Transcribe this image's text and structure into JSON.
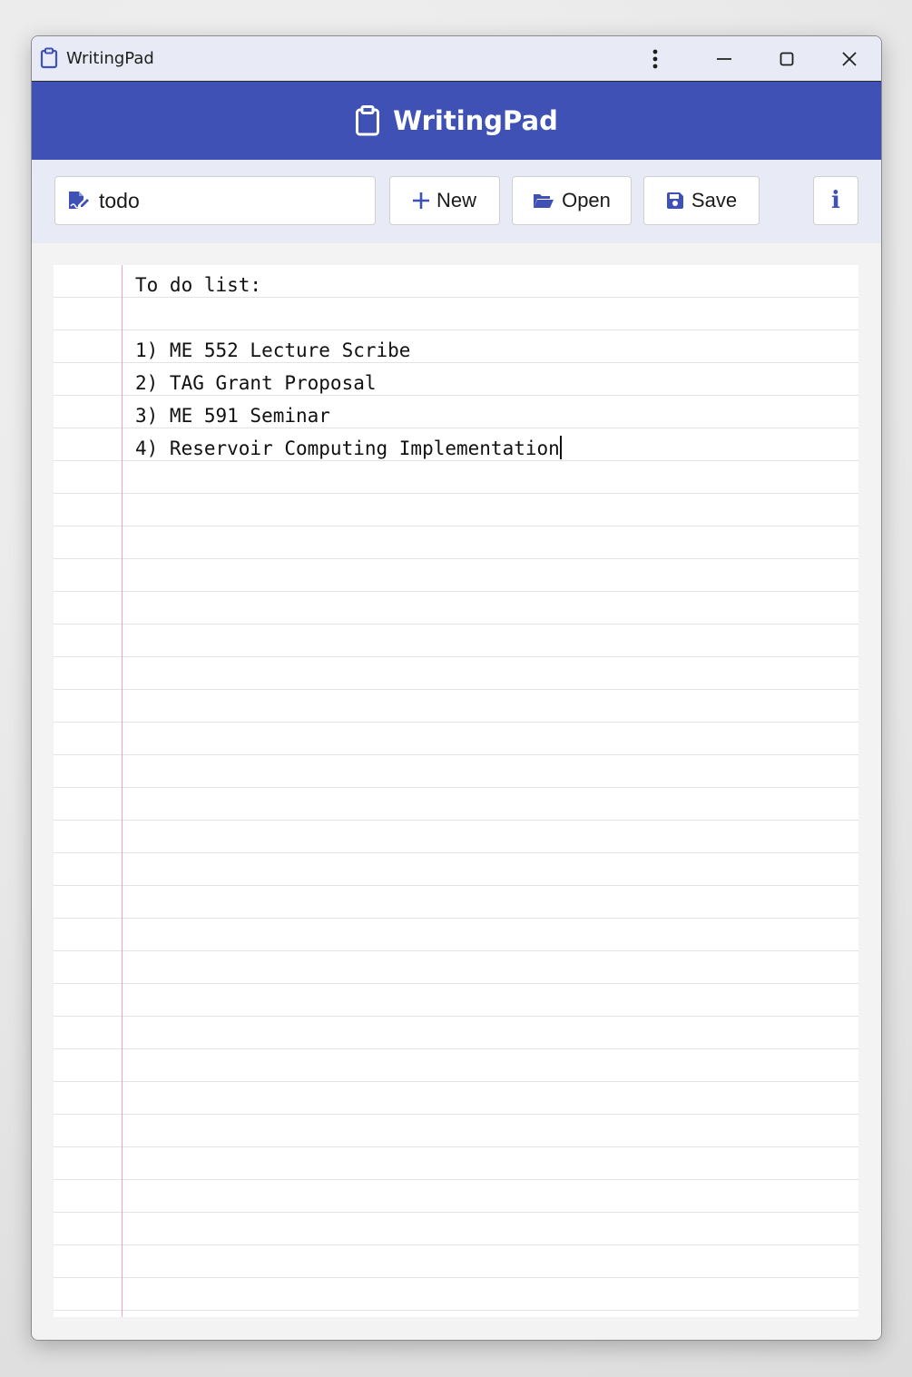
{
  "window": {
    "title": "WritingPad"
  },
  "header": {
    "title": "WritingPad"
  },
  "toolbar": {
    "filename_value": "todo",
    "new_label": "New",
    "open_label": "Open",
    "save_label": "Save",
    "info_label": "i"
  },
  "document": {
    "lines": [
      "To do list:",
      "",
      "1) ME 552 Lecture Scribe",
      "2) TAG Grant Proposal",
      "3) ME 591 Seminar",
      "4) Reservoir Computing Implementation"
    ]
  },
  "colors": {
    "accent": "#3f51b5",
    "toolbar_bg": "#e8eaf6",
    "margin_line": "#f4a6b4",
    "rule_line": "#e3e3e3"
  },
  "icons": {
    "app": "clipboard-icon",
    "file": "file-signature-icon",
    "new": "plus-icon",
    "open": "folder-open-icon",
    "save": "floppy-disk-icon",
    "info": "info-icon",
    "menu": "more-vertical-icon",
    "minimize": "minimize-icon",
    "maximize": "maximize-icon",
    "close": "close-icon"
  }
}
